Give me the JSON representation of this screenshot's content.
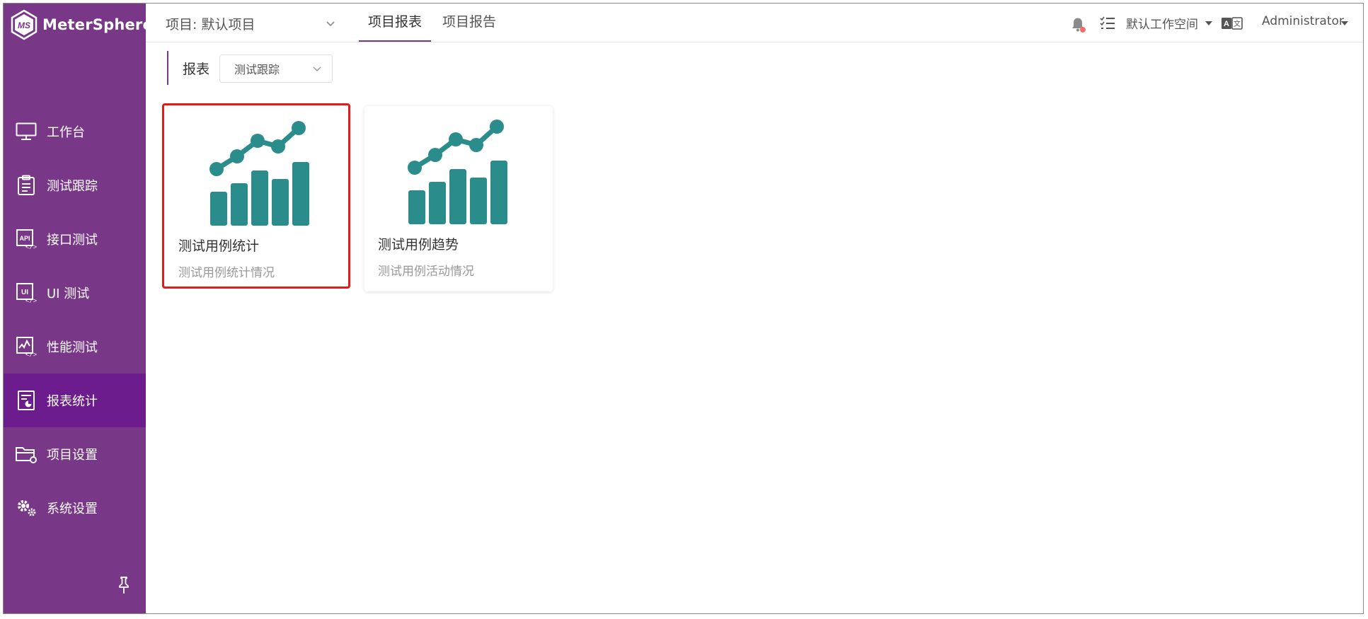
{
  "app": {
    "name": "MeterSphere",
    "logo_letters": "MS",
    "brand_color": "#783887"
  },
  "sidebar": {
    "items": [
      {
        "label": "工作台",
        "icon": "monitor-icon",
        "active": false
      },
      {
        "label": "测试跟踪",
        "icon": "clipboard-list-icon",
        "active": false
      },
      {
        "label": "接口测试",
        "icon": "api-code-icon",
        "active": false
      },
      {
        "label": "UI 测试",
        "icon": "ui-code-icon",
        "active": false
      },
      {
        "label": "性能测试",
        "icon": "performance-chart-icon",
        "active": false
      },
      {
        "label": "报表统计",
        "icon": "report-chart-icon",
        "active": true
      },
      {
        "label": "项目设置",
        "icon": "folder-gear-icon",
        "active": false
      },
      {
        "label": "系统设置",
        "icon": "gears-icon",
        "active": false
      }
    ],
    "pin_icon": "pin-icon"
  },
  "header": {
    "project_select": "项目: 默认项目",
    "tabs": [
      {
        "label": "项目报表",
        "active": true
      },
      {
        "label": "项目报告",
        "active": false
      }
    ],
    "workspace": "默认工作空间",
    "user": "Administrator",
    "notification_dot_color": "#f56c6c"
  },
  "main": {
    "breadcrumb_label": "报表",
    "report_type_select": "测试跟踪",
    "cards": [
      {
        "title": "测试用例统计",
        "desc": "测试用例统计情况",
        "selected": true
      },
      {
        "title": "测试用例趋势",
        "desc": "测试用例活动情况",
        "selected": false
      }
    ],
    "card_icon_color": "#2b8d8b",
    "highlight_color": "#e21a1a"
  }
}
